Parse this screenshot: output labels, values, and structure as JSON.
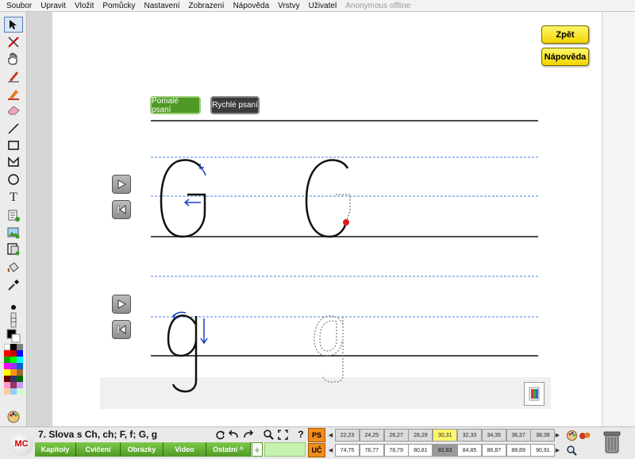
{
  "menu": {
    "items": [
      "Soubor",
      "Upravit",
      "Vložit",
      "Pomůcky",
      "Nastavení",
      "Zobrazení",
      "Nápověda",
      "Vrstvy",
      "Uživatel"
    ],
    "status": "Anonymous offline"
  },
  "toolbar_icons": [
    "cursor-icon",
    "eraser-x-icon",
    "hand-icon",
    "pen-icon",
    "highlighter-icon",
    "eraser-icon",
    "line-icon",
    "rectangle-icon",
    "polygon-icon",
    "ellipse-icon",
    "text-icon",
    "note-icon",
    "image-icon",
    "copy-icon",
    "bucket-icon",
    "eyedropper-icon",
    "dot-icon",
    "size-icon",
    "color-black-icon",
    "palette-icon"
  ],
  "colors": {
    "accent_green": "#4f9a25",
    "yellow_button": "#f2d600",
    "page_label": "#f28c1c",
    "guide_line": "#4a7fd6",
    "stroke_arrow": "#1a3fc4",
    "start_dot": "#e21b1b"
  },
  "canvas": {
    "back_button": "Zpět",
    "help_button": "Nápověda",
    "slow_writing": "Pomalé psaní",
    "fast_writing": "Rychlé psaní",
    "row1_letter_model": "G",
    "row2_letter_model": "g"
  },
  "bottom": {
    "lesson_title": "7. Slova s Ch, ch; F, f; G, g",
    "logo_text": "MC",
    "tabs": [
      "Kapitoly",
      "Cvičení",
      "Obrázky",
      "Video",
      "Ostatní ^"
    ],
    "ps_label": "PS",
    "uc_label": "UČ",
    "ps_pages": [
      "22,23",
      "24,25",
      "26,27",
      "28,29",
      "30,31",
      "32,33",
      "34,35",
      "36,37",
      "38,39"
    ],
    "uc_pages": [
      "74,75",
      "76,77",
      "78,79",
      "80,81",
      "82,83",
      "84,85",
      "86,87",
      "88,89",
      "90,91"
    ],
    "ps_highlight_index": 4,
    "uc_selected_index": 4
  }
}
